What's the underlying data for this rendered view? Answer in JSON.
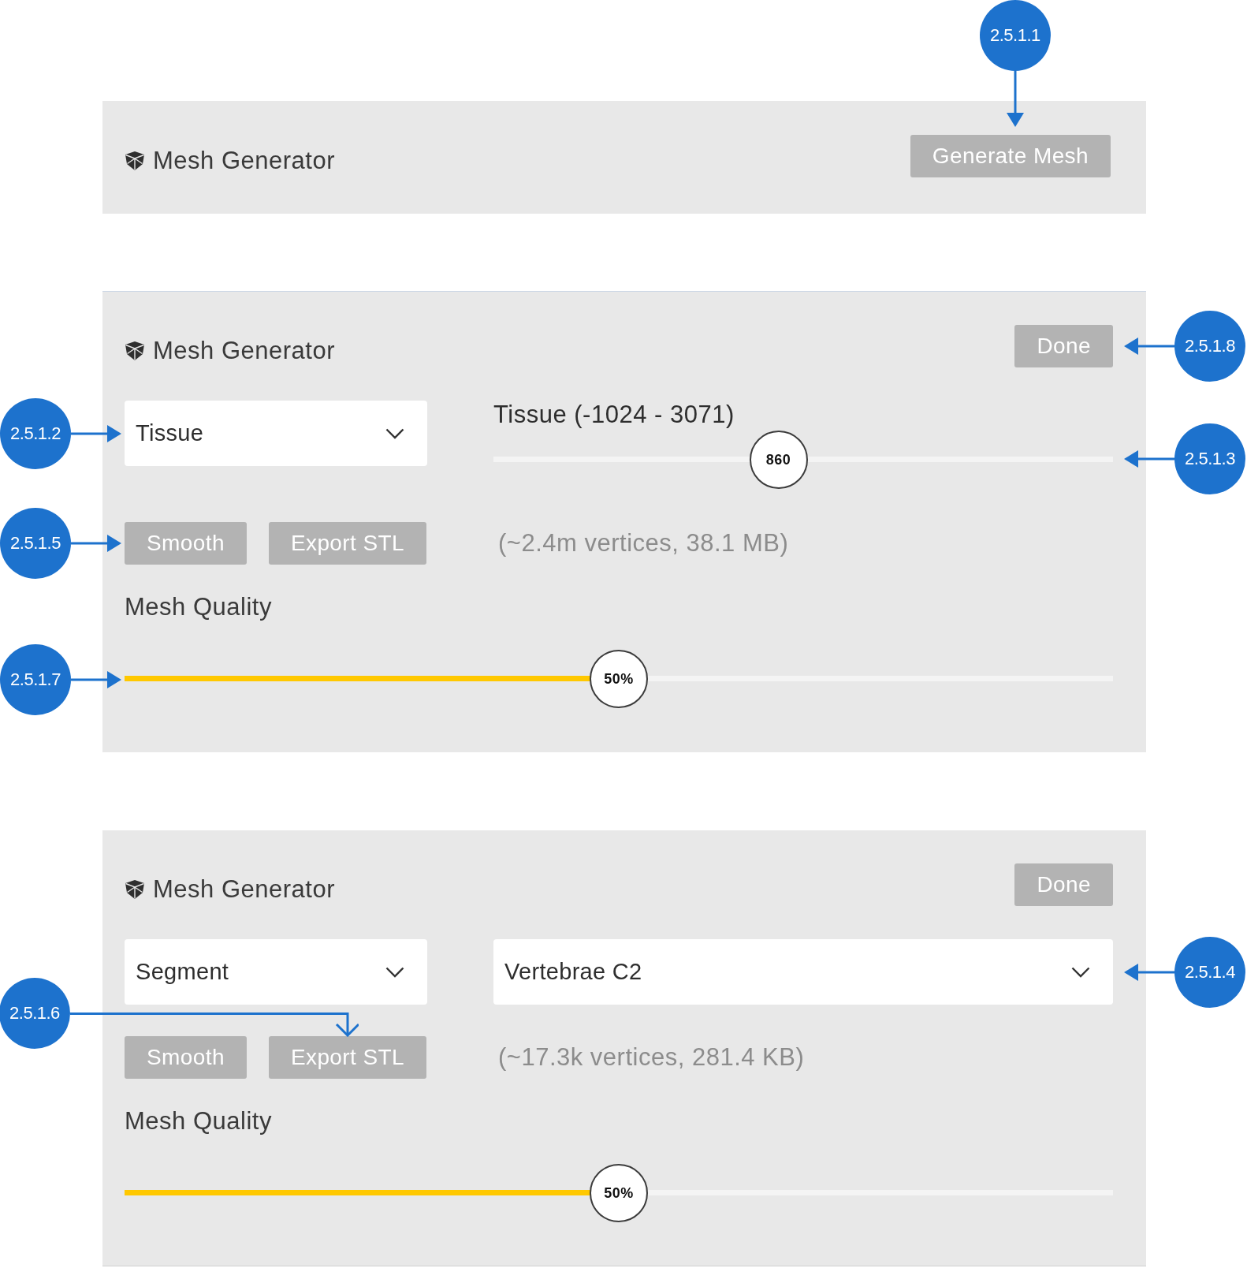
{
  "panels": [
    {
      "kind": "start",
      "title": "Mesh Generator",
      "action_button": {
        "label": "Generate Mesh",
        "callout": {
          "number": "2.5.1.1",
          "kind": "top"
        }
      }
    },
    {
      "kind": "threshold",
      "title": "Mesh Generator",
      "action_button": {
        "label": "Done",
        "callout": {
          "number": "2.5.1.8",
          "kind": "right"
        }
      },
      "mode_select": {
        "value": "Tissue",
        "callout": {
          "number": "2.5.1.2",
          "kind": "left"
        }
      },
      "threshold": {
        "label": "Tissue (-1024 - 3071)",
        "reading": "860",
        "level": 0.46,
        "callout": {
          "number": "2.5.1.3",
          "kind": "right"
        }
      },
      "buttons": [
        {
          "label": "Smooth",
          "callout": {
            "number": "2.5.1.5",
            "kind": "left"
          }
        },
        {
          "label": "Export STL"
        }
      ],
      "mesh_info": "(~2.4m vertices, 38.1 MB)",
      "quality": {
        "label": "Mesh Quality",
        "reading": "50%",
        "level": 0.5,
        "callout": {
          "number": "2.5.1.7",
          "kind": "left"
        }
      }
    },
    {
      "kind": "segment",
      "title": "Mesh Generator",
      "action_button": {
        "label": "Done"
      },
      "mode_select": {
        "value": "Segment"
      },
      "segment_select": {
        "value": "Vertebrae C2",
        "callout": {
          "number": "2.5.1.4",
          "kind": "right"
        }
      },
      "buttons": [
        {
          "label": "Smooth"
        },
        {
          "label": "Export STL",
          "callout": {
            "number": "2.5.1.6",
            "kind": "elbow"
          }
        }
      ],
      "mesh_info": "(~17.3k vertices, 281.4 KB)",
      "quality": {
        "label": "Mesh Quality",
        "reading": "50%",
        "level": 0.5
      }
    }
  ]
}
